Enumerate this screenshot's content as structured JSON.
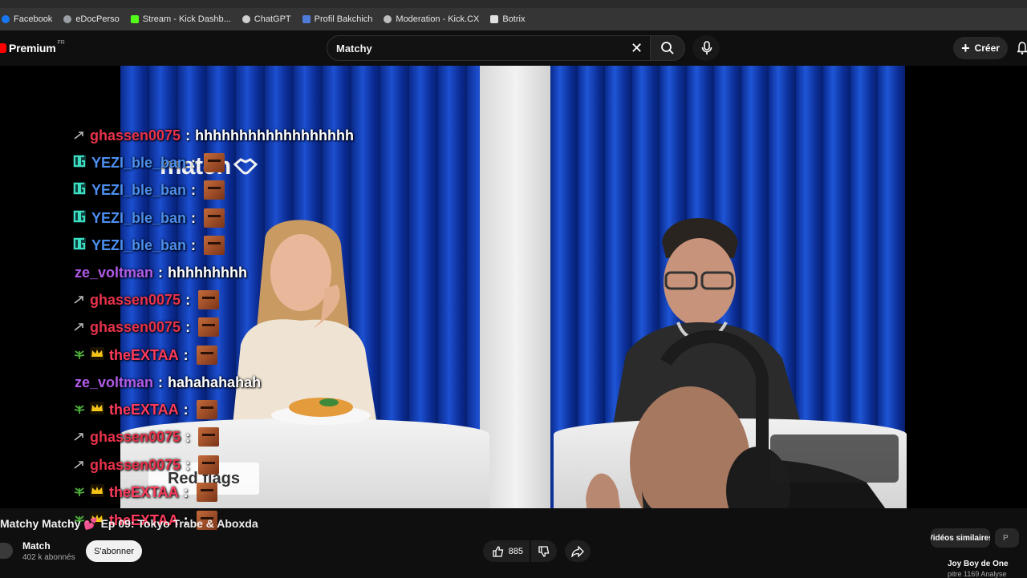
{
  "bookmarks": [
    {
      "label": "Facebook",
      "icon": "facebook-icon",
      "color": "#1877f2"
    },
    {
      "label": "eDocPerso",
      "icon": "globe-icon",
      "color": "#9aa0a6"
    },
    {
      "label": "Stream - Kick Dashb...",
      "icon": "kick-icon",
      "color": "#53fc18"
    },
    {
      "label": "ChatGPT",
      "icon": "chatgpt-icon",
      "color": "#cfcfcf"
    },
    {
      "label": "Profil Bakchich",
      "icon": "bakchich-icon",
      "color": "#4f7bd8"
    },
    {
      "label": "Moderation - Kick.CX",
      "icon": "gear-icon",
      "color": "#bdbdbd"
    },
    {
      "label": "Botrix",
      "icon": "botrix-icon",
      "color": "#e0e0e0"
    }
  ],
  "header": {
    "logo_text": "Premium",
    "logo_region": "FR",
    "search_value": "Matchy",
    "create_label": "Créer"
  },
  "video": {
    "brand_logo": "match",
    "sign_text": "Red flags"
  },
  "chat": [
    {
      "user": "ghassen0075",
      "color": "#e8324a",
      "badge": "arrow",
      "text": "hhhhhhhhhhhhhhhhhh",
      "emote": false
    },
    {
      "user": "YEZI_ble_ban",
      "color": "#4b8ff0",
      "badge": "og",
      "text": "",
      "emote": true
    },
    {
      "user": "YEZI_ble_ban",
      "color": "#4b8ff0",
      "badge": "og",
      "text": "",
      "emote": true
    },
    {
      "user": "YEZI_ble_ban",
      "color": "#4b8ff0",
      "badge": "og",
      "text": "",
      "emote": true
    },
    {
      "user": "YEZI_ble_ban",
      "color": "#4b8ff0",
      "badge": "og",
      "text": "",
      "emote": true
    },
    {
      "user": "ze_voltman",
      "color": "#b05be8",
      "badge": "",
      "text": "hhhhhhhhh",
      "emote": false
    },
    {
      "user": "ghassen0075",
      "color": "#e8324a",
      "badge": "arrow",
      "text": "",
      "emote": true
    },
    {
      "user": "ghassen0075",
      "color": "#e8324a",
      "badge": "arrow",
      "text": "",
      "emote": true
    },
    {
      "user": "theEXTAA",
      "color": "#ff3b5c",
      "badge": "crown",
      "text": "",
      "emote": true
    },
    {
      "user": "ze_voltman",
      "color": "#b05be8",
      "badge": "",
      "text": "hahahahahah",
      "emote": false
    },
    {
      "user": "theEXTAA",
      "color": "#ff3b5c",
      "badge": "crown",
      "text": "",
      "emote": true
    },
    {
      "user": "ghassen0075",
      "color": "#e8324a",
      "badge": "arrow",
      "text": "",
      "emote": true
    },
    {
      "user": "ghassen0075",
      "color": "#e8324a",
      "badge": "arrow",
      "text": "",
      "emote": true
    },
    {
      "user": "theEXTAA",
      "color": "#ff3b5c",
      "badge": "crown",
      "text": "",
      "emote": true
    },
    {
      "user": "theEXTAA",
      "color": "#ff3b5c",
      "badge": "crown",
      "text": "",
      "emote": true
    }
  ],
  "video_title": "Matchy Matchy 💕 Ep 09: Tokyo Trabe & Aboxda",
  "channel": {
    "name": "Match",
    "subs": "402 k abonnés",
    "subscribe_label": "S'abonner"
  },
  "actions": {
    "likes": "885"
  },
  "sidebar": {
    "chip_label": "Vidéos similaires",
    "chip2_label": "P",
    "rec_title": "Joy Boy de One",
    "rec_sub": "pitre 1169 Analyse"
  }
}
